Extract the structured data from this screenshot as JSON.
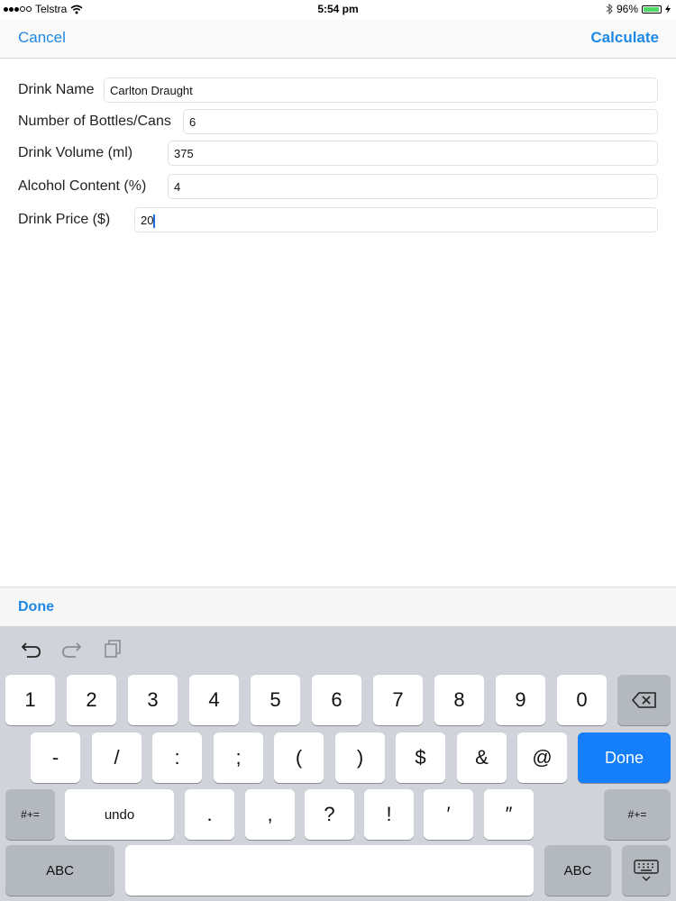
{
  "status": {
    "carrier": "Telstra",
    "time": "5:54 pm",
    "battery": "96%",
    "battery_level": 0.96
  },
  "nav": {
    "cancel": "Cancel",
    "calculate": "Calculate"
  },
  "form": {
    "drink_name": {
      "label": "Drink Name",
      "value": "Carlton Draught"
    },
    "bottles": {
      "label": "Number of Bottles/Cans",
      "value": "6"
    },
    "volume": {
      "label": "Drink Volume (ml)",
      "value": "375"
    },
    "alcohol": {
      "label": "Alcohol Content (%)",
      "value": "4"
    },
    "price": {
      "label": "Drink Price ($)",
      "value": "20"
    }
  },
  "accessory": {
    "done": "Done"
  },
  "keyboard": {
    "shortcut_icons": [
      "undo-icon",
      "redo-icon",
      "paste-icon"
    ],
    "row1": [
      "1",
      "2",
      "3",
      "4",
      "5",
      "6",
      "7",
      "8",
      "9",
      "0"
    ],
    "row2": [
      "-",
      "/",
      ":",
      ";",
      "(",
      ")",
      "$",
      "&",
      "@"
    ],
    "row3": [
      ".",
      ",",
      "?",
      "!",
      "′",
      "″"
    ],
    "done": "Done",
    "undo": "undo",
    "symbols": "#+=",
    "abc": "ABC",
    "backspace_icon": "backspace-icon",
    "dismiss_icon": "keyboard-dismiss-icon"
  }
}
